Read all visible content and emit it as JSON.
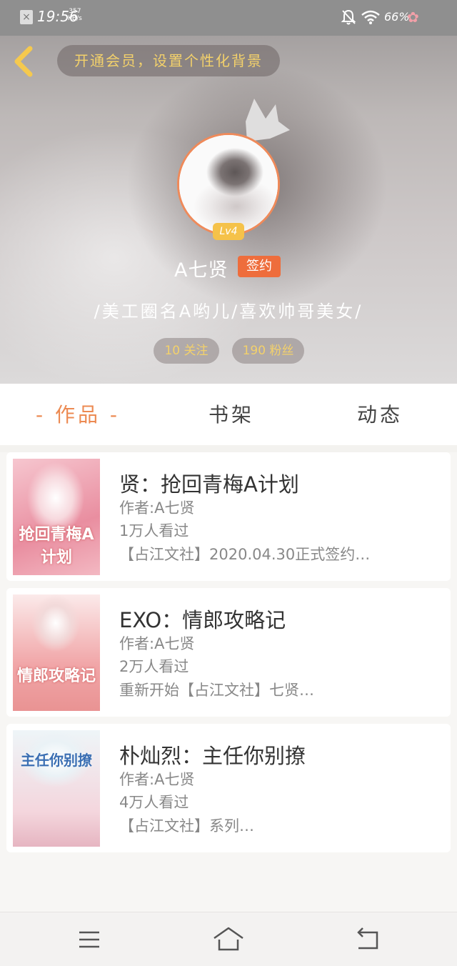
{
  "status_bar": {
    "time": "19:56",
    "speed_value": "357",
    "speed_unit": "KB/s",
    "battery": "66%"
  },
  "header": {
    "vip_prompt": "开通会员，设置个性化背景",
    "level": "Lv4",
    "username": "A七贤",
    "sign_badge": "签约",
    "bio": "/美工圈名A哟儿/喜欢帅哥美女/",
    "following": "10 关注",
    "fans": "190 粉丝"
  },
  "tabs": [
    {
      "label": "- 作品 -",
      "active": true
    },
    {
      "label": "书架",
      "active": false
    },
    {
      "label": "动态",
      "active": false
    }
  ],
  "books": [
    {
      "title": "贤：抢回青梅A计划",
      "author": "作者:A七贤",
      "views": "1万人看过",
      "desc": "【占江文社】2020.04.30正式签约…",
      "cover_text": "抢回青梅A计划"
    },
    {
      "title": "EXO：情郎攻略记",
      "author": "作者:A七贤",
      "views": "2万人看过",
      "desc": "重新开始【占江文社】七贤…",
      "cover_text": "情郎攻略记"
    },
    {
      "title": "朴灿烈：主任你别撩",
      "author": "作者:A七贤",
      "views": "4万人看过",
      "desc": "【占江文社】系列…",
      "cover_text": "主任你别撩"
    }
  ],
  "colors": {
    "accent": "#ec8a52",
    "gold": "#f3d16b",
    "sign_badge": "#ee6d3c",
    "level_badge": "#f5c24a"
  },
  "icons": [
    "close-notification-icon",
    "bell-off-icon",
    "wifi-icon",
    "flower-icon",
    "back-chevron-icon",
    "crown-icon",
    "menu-icon",
    "home-icon",
    "back-icon"
  ]
}
